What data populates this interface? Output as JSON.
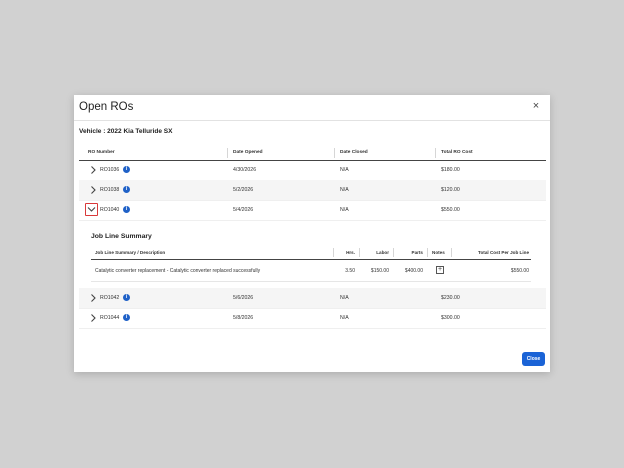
{
  "modal": {
    "title": "Open ROs",
    "close_icon": "×",
    "vehicle_label": "Vehicle : 2022 Kia Telluride SX",
    "close_button": "Close"
  },
  "table": {
    "headers": [
      "RO Number",
      "Date Opened",
      "Date Closed",
      "Total RO Cost"
    ],
    "rows": [
      {
        "ro": "RO1036",
        "opened": "4/30/2026",
        "closed": "N/A",
        "cost": "$180.00"
      },
      {
        "ro": "RO1038",
        "opened": "5/2/2026",
        "closed": "N/A",
        "cost": "$120.00"
      },
      {
        "ro": "RO1040",
        "opened": "5/4/2026",
        "closed": "N/A",
        "cost": "$550.00"
      },
      {
        "ro": "RO1042",
        "opened": "5/6/2026",
        "closed": "N/A",
        "cost": "$230.00"
      },
      {
        "ro": "RO1044",
        "opened": "5/8/2026",
        "closed": "N/A",
        "cost": "$300.00"
      }
    ]
  },
  "job_summary": {
    "title": "Job Line Summary",
    "headers": [
      "Job Line Summary / Description",
      "Hrs.",
      "Labor",
      "Parts",
      "Notes",
      "Total Cost Per Job Line"
    ],
    "row": {
      "description": "Catalytic converter replacement - Catalytic converter replaced successfully",
      "hrs": "3.50",
      "labor": "$150.00",
      "parts": "$400.00",
      "notes_icon": "+",
      "total": "$550.00"
    }
  },
  "icons": {
    "info": "i",
    "info_color": "#1f61c7",
    "accent": "#1a63d6",
    "highlight": "#d9393a"
  }
}
